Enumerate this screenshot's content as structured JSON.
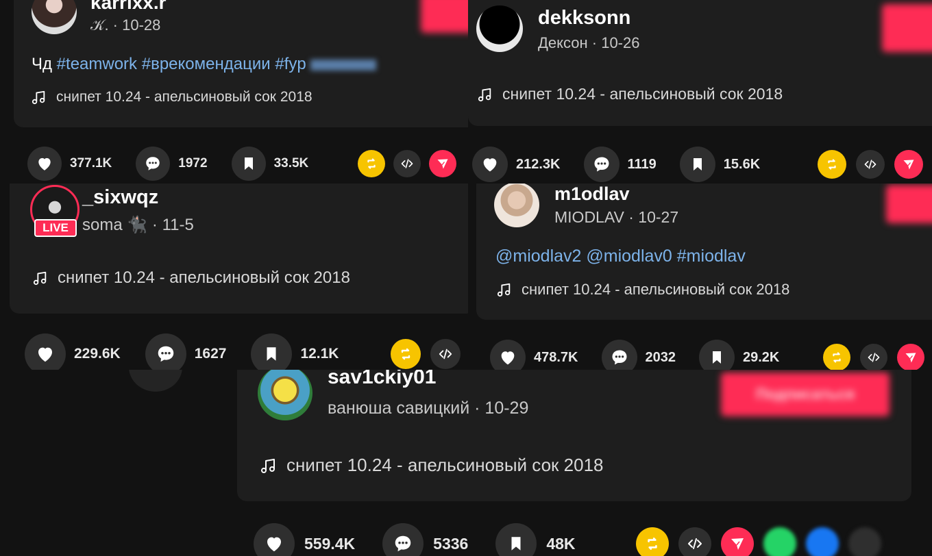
{
  "posts": [
    {
      "username": "karrixx.r",
      "display_name": "𝒦.",
      "date": "10-28",
      "description": {
        "prefix": "Чд",
        "tags": [
          "#teamwork",
          "#врекомендации",
          "#fyp"
        ]
      },
      "music": "снипет 10.24 - апельсиновый сок 2018",
      "likes": "377.1K",
      "comments": "1972",
      "saves": "33.5K"
    },
    {
      "username": "dekksonn",
      "display_name": "Дексон",
      "date": "10-26",
      "music": "снипет 10.24 - апельсиновый сок 2018",
      "likes": "212.3K",
      "comments": "1119",
      "saves": "15.6K"
    },
    {
      "username": "_sixwqz",
      "display_name": "soma 🐈‍⬛",
      "date": "11-5",
      "live_badge": "LIVE",
      "music": "снипет 10.24 - апельсиновый сок 2018",
      "likes": "229.6K",
      "comments": "1627",
      "saves": "12.1K"
    },
    {
      "username": "m1odlav",
      "display_name": "MIODLAV",
      "date": "10-27",
      "description": {
        "tags": [
          "@miodlav2",
          "@miodlav0",
          "#miodlav"
        ]
      },
      "music": "снипет 10.24 - апельсиновый сок 2018",
      "likes": "478.7K",
      "comments": "2032",
      "saves": "29.2K"
    },
    {
      "username": "sav1ckiy01",
      "display_name": "ванюша савицкий",
      "date": "10-29",
      "follow_label": "Подписаться",
      "music": "снипет 10.24 - апельсиновый сок 2018",
      "likes": "559.4K",
      "comments": "5336",
      "saves": "48K"
    }
  ],
  "icons": {
    "music": "music-note-icon",
    "like": "heart-icon",
    "comment": "comment-icon",
    "save": "bookmark-icon",
    "repost": "repost-icon",
    "embed": "code-icon",
    "share": "send-icon"
  },
  "colors": {
    "accent": "#fe2c55",
    "repost": "#f7c400",
    "tag": "#7db3ea",
    "whatsapp": "#25d366",
    "facebook": "#1877f2"
  }
}
